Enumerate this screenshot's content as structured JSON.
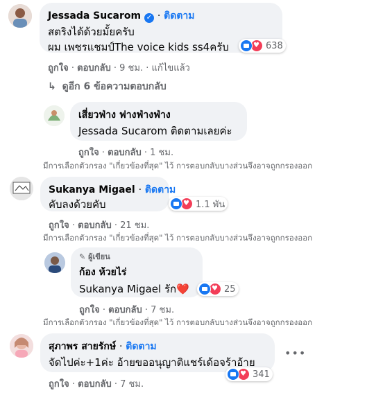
{
  "colors": {
    "accent": "#1877f2",
    "bubble": "#f0f2f5",
    "meta": "#65676b",
    "love": "#f33e58"
  },
  "comments": [
    {
      "author": "Jessada Sucarom",
      "follow": "ติดตาม",
      "line1": "สตริงได้ด้วยมั้ยครับ",
      "line2": "ผม เพชรแชมป์The voice kids ss4ครับ",
      "reactions": "638",
      "like": "ถูกใจ",
      "reply": "ตอบกลับ",
      "time": "9 ชม.",
      "edited": "แก้ไขแล้ว"
    },
    {
      "view_more": "ดูอีก 6 ข้อความตอบกลับ"
    },
    {
      "author": "เสี่ยวฟ่าง ฟางฟ่างฟ่าง",
      "line1": "Jessada Sucarom ติดตามเลยค่ะ",
      "like": "ถูกใจ",
      "reply": "ตอบกลับ",
      "time": "1 ชม."
    },
    {
      "author": "Sukanya Migael",
      "follow": "ติดตาม",
      "line1": "คับลงด้วยคับ",
      "reactions": "1.1 พัน",
      "like": "ถูกใจ",
      "reply": "ตอบกลับ",
      "time": "21 ชม."
    },
    {
      "badge": "ผู้เขียน",
      "author": "ก้อง ห้วยไร่",
      "line1": "Sukanya Migael รัก❤️",
      "reactions": "25",
      "like": "ถูกใจ",
      "reply": "ตอบกลับ",
      "time": "7 ชม."
    },
    {
      "author": "สุภาพร สายรักษ์",
      "follow": "ติดตาม",
      "line1": "จัดไปค่ะ+1ค่ะ อ้ายขออนุญาติแชร์เด้อจร้าอ้าย",
      "reactions": "341",
      "like": "ถูกใจ",
      "reply": "ตอบกลับ",
      "time": "7 ชม."
    }
  ],
  "filter_note": "มีการเลือกตัวกรอง \"เกี่ยวข้องที่สุด\" ไว้ การตอบกลับบางส่วนจึงอาจถูกกรองออก",
  "separator": "·"
}
